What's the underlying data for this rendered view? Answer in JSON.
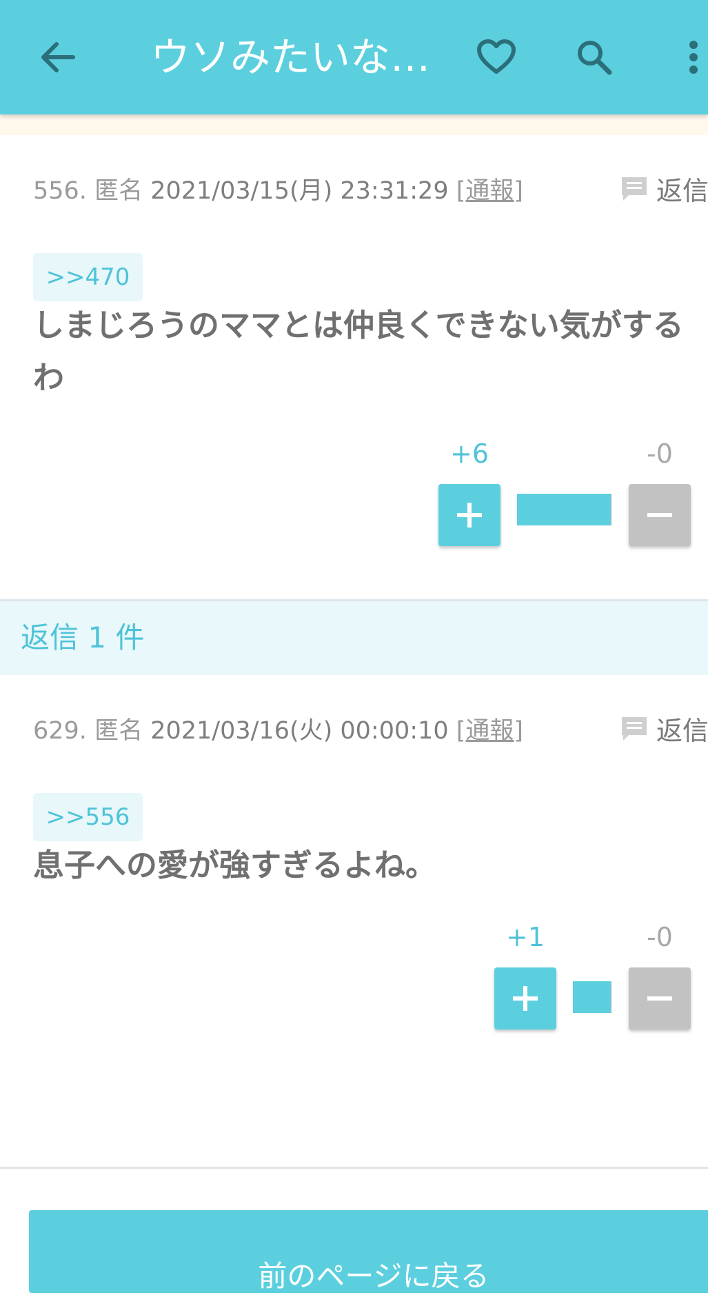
{
  "appbar": {
    "title": "ウソみたいな…",
    "icons": [
      "arrow-back-icon",
      "heart-icon",
      "search-icon",
      "more-vert-icon"
    ]
  },
  "posts": [
    {
      "number": "556.",
      "author": "匿名",
      "date": "2021/03/15(月) 23:31:29",
      "report": "[通報]",
      "reply_label": "返信",
      "anchor": ">>470",
      "body": "しまじろうのママとは仲良くできない気がするわ",
      "plus_count": "+6",
      "minus_count": "-0",
      "plus_share": 1.0
    },
    {
      "number": "629.",
      "author": "匿名",
      "date": "2021/03/16(火) 00:00:10",
      "report": "[通報]",
      "reply_label": "返信",
      "anchor": ">>556",
      "body": "息子への愛が強すぎるよね。",
      "plus_count": "+1",
      "minus_count": "-0",
      "plus_share": 1.0
    }
  ],
  "replies_header": "返信 1 件",
  "prev_page_label": "前のページに戻る",
  "colors": {
    "accent": "#5ccfdf",
    "text": "#707070",
    "minus_button": "#c2c2c2"
  }
}
